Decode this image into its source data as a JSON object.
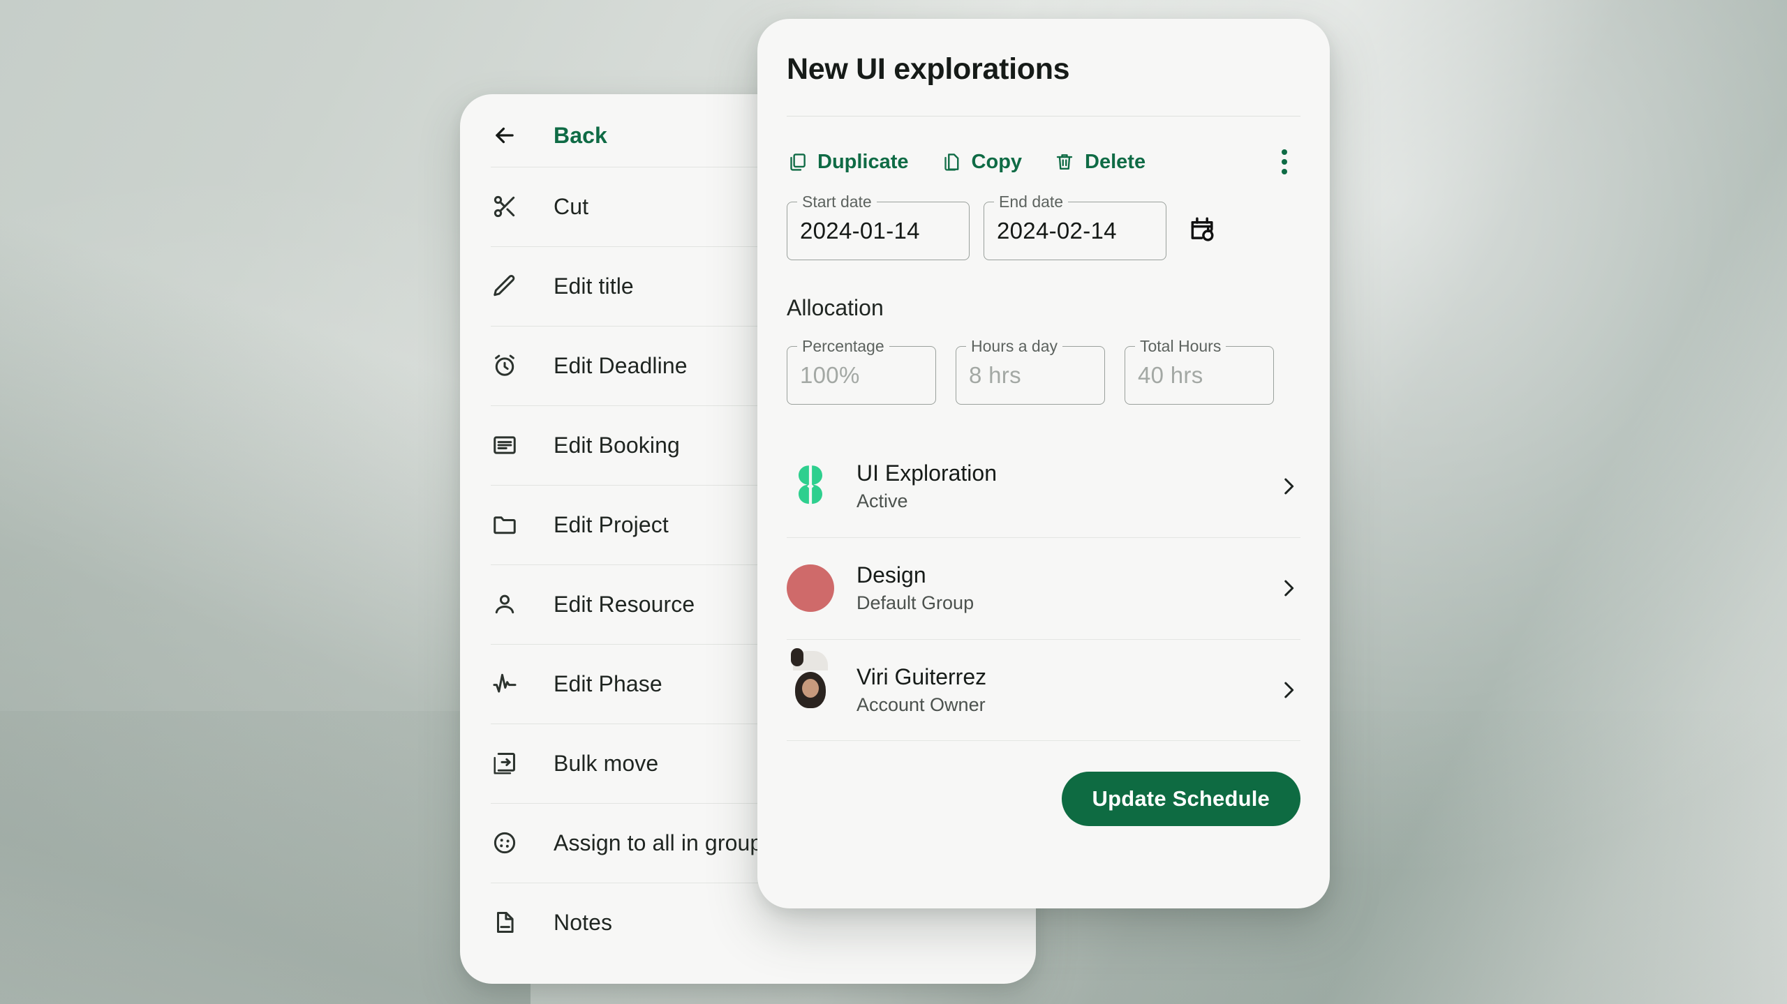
{
  "theme": {
    "accent_green": "#0f6b45",
    "button_green": "#0e6b42",
    "clover_green": "#2ecf8e",
    "group_red": "#cf6a6a",
    "card_bg": "#f7f7f6",
    "page_bg": "#dde2df"
  },
  "menu_panel": {
    "back": {
      "label": "Back",
      "icon": "arrow-left-icon"
    },
    "items": [
      {
        "label": "Cut",
        "icon": "scissors-icon"
      },
      {
        "label": "Edit title",
        "icon": "pencil-icon"
      },
      {
        "label": "Edit Deadline",
        "icon": "alarm-clock-icon"
      },
      {
        "label": "Edit Booking",
        "icon": "booking-list-icon"
      },
      {
        "label": "Edit Project",
        "icon": "folder-icon"
      },
      {
        "label": "Edit Resource",
        "icon": "person-icon"
      },
      {
        "label": "Edit Phase",
        "icon": "pulse-icon"
      },
      {
        "label": "Bulk move",
        "icon": "bulk-move-icon"
      },
      {
        "label": "Assign to all in group",
        "icon": "group-assign-icon"
      },
      {
        "label": "Notes",
        "icon": "note-icon"
      }
    ]
  },
  "detail_panel": {
    "title": "New UI explorations",
    "actions": [
      {
        "label": "Duplicate",
        "icon": "duplicate-icon"
      },
      {
        "label": "Copy",
        "icon": "copy-icon"
      },
      {
        "label": "Delete",
        "icon": "trash-icon"
      }
    ],
    "more_menu_icon": "more-vertical-icon",
    "dates": {
      "start": {
        "label": "Start date",
        "value": "2024-01-14"
      },
      "end": {
        "label": "End date",
        "value": "2024-02-14"
      },
      "reset_icon": "calendar-reset-icon"
    },
    "allocation": {
      "heading": "Allocation",
      "fields": [
        {
          "label": "Percentage",
          "value": "100%"
        },
        {
          "label": "Hours a day",
          "value": "8 hrs"
        },
        {
          "label": "Total Hours",
          "value": "40 hrs"
        }
      ]
    },
    "entities": [
      {
        "name": "UI Exploration",
        "sub": "Active",
        "avatar": "clover-icon"
      },
      {
        "name": "Design",
        "sub": "Default Group",
        "avatar": "red-circle-avatar"
      },
      {
        "name": "Viri Guiterrez",
        "sub": "Account Owner",
        "avatar": "user-photo-avatar"
      }
    ],
    "footer": {
      "update_label": "Update Schedule"
    }
  }
}
